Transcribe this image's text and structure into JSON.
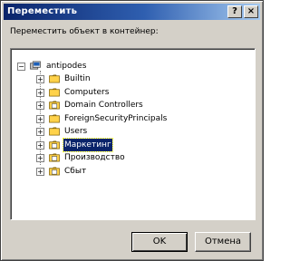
{
  "window": {
    "title": "Переместить",
    "help_label": "?",
    "close_label": "×"
  },
  "prompt": "Переместить объект в контейнер:",
  "tree": {
    "root": {
      "label": "antipodes",
      "icon": "domain-icon",
      "expanded": true
    },
    "items": [
      {
        "label": "Builtin",
        "icon": "folder-icon",
        "expander": "+",
        "selected": false
      },
      {
        "label": "Computers",
        "icon": "folder-icon",
        "expander": "+",
        "selected": false
      },
      {
        "label": "Domain Controllers",
        "icon": "ou-folder-icon",
        "expander": "+",
        "selected": false
      },
      {
        "label": "ForeignSecurityPrincipals",
        "icon": "folder-icon",
        "expander": "+",
        "selected": false
      },
      {
        "label": "Users",
        "icon": "folder-icon",
        "expander": "+",
        "selected": false
      },
      {
        "label": "Маркетинг",
        "icon": "ou-folder-icon",
        "expander": "+",
        "selected": true
      },
      {
        "label": "Производство",
        "icon": "ou-folder-icon",
        "expander": "+",
        "selected": false
      },
      {
        "label": "Сбыт",
        "icon": "ou-folder-icon",
        "expander": "+",
        "selected": false
      }
    ],
    "root_expander": "−"
  },
  "buttons": {
    "ok": "OK",
    "cancel": "Отмена"
  },
  "colors": {
    "title_start": "#0a246a",
    "title_end": "#a6caf0",
    "face": "#d4d0c8",
    "selection": "#0a246a",
    "folder": "#ffd24a"
  }
}
